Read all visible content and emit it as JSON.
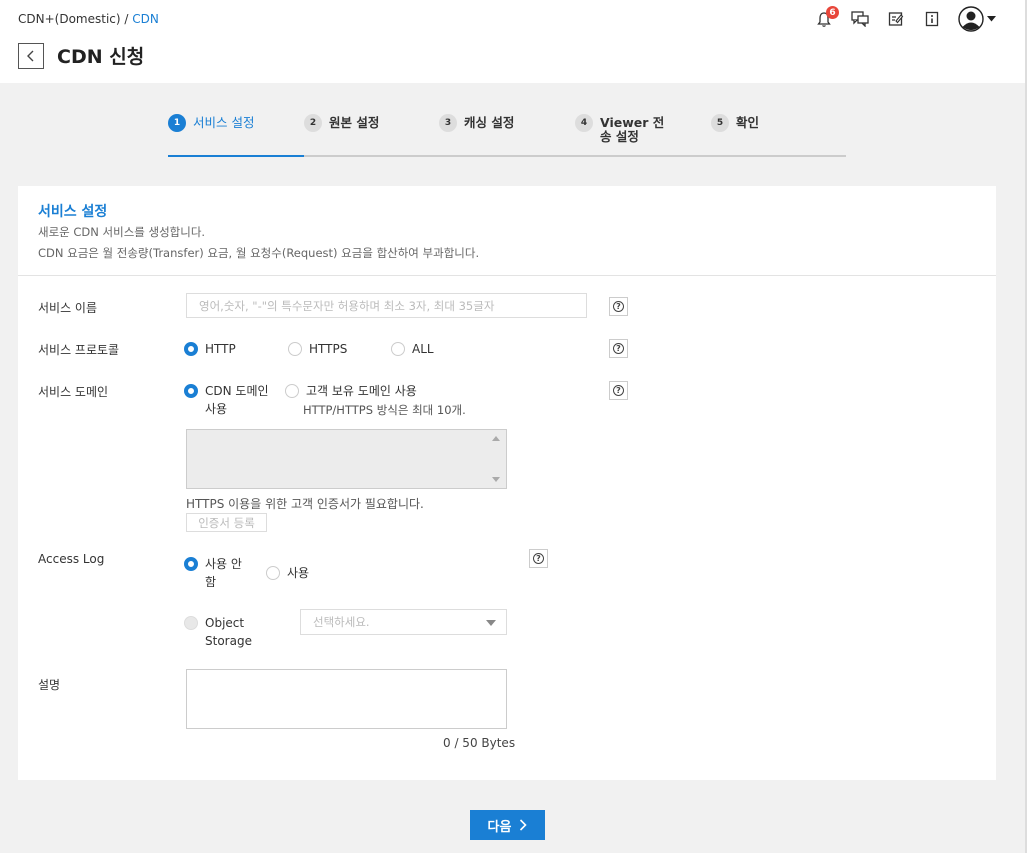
{
  "breadcrumb": {
    "parent": "CDN+(Domestic) / ",
    "current": "CDN"
  },
  "page": {
    "title": "CDN 신청"
  },
  "notifications": {
    "count": "6"
  },
  "steps": [
    {
      "num": "1",
      "label": "서비스 설정"
    },
    {
      "num": "2",
      "label": "원본 설정"
    },
    {
      "num": "3",
      "label": "캐싱 설정"
    },
    {
      "num": "4",
      "label": "Viewer 전송 설정"
    },
    {
      "num": "5",
      "label": "확인"
    }
  ],
  "card": {
    "title": "서비스 설정",
    "desc1": "새로운 CDN 서비스를 생성합니다.",
    "desc2": "CDN 요금은 월 전송량(Transfer) 요금, 월 요청수(Request) 요금을 합산하여 부과합니다."
  },
  "form": {
    "service_name": {
      "label": "서비스 이름",
      "placeholder": "영어,숫자, \"-\"의 특수문자만 허용하며 최소 3자, 최대 35글자"
    },
    "protocol": {
      "label": "서비스 프로토콜",
      "options": [
        "HTTP",
        "HTTPS",
        "ALL"
      ],
      "selected": "HTTP"
    },
    "domain": {
      "label": "서비스 도메인",
      "opt_cdn": "CDN 도메인 사용",
      "opt_custom": "고객 보유 도메인 사용",
      "custom_note": "HTTP/HTTPS 방식은 최대 10개.",
      "cert_note": "HTTPS 이용을 위한 고객 인증서가 필요합니다.",
      "cert_button": "인증서 등록"
    },
    "access_log": {
      "label": "Access Log",
      "opt_off": "사용 안 함",
      "opt_on": "사용",
      "opt_storage": "Object Storage",
      "storage_placeholder": "선택하세요."
    },
    "description": {
      "label": "설명",
      "counter": "0 / 50 Bytes"
    }
  },
  "footer": {
    "next_label": "다음"
  }
}
